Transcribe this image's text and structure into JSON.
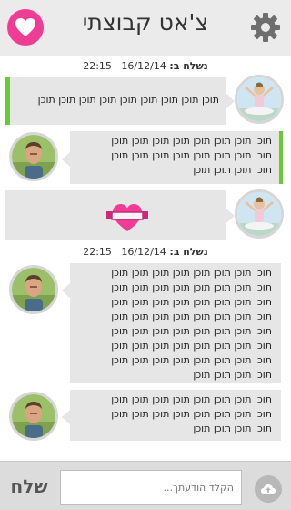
{
  "header": {
    "title": "צ'אט קבוצתי",
    "accent": "#ef3d96"
  },
  "messages": [
    {
      "type": "stamp",
      "label": "נשלח ב:",
      "date": "16/12/14",
      "time": "22:15"
    },
    {
      "type": "text",
      "side": "mine",
      "avatar": "woman-yoga",
      "lines": [
        "תוכן תוכן תוכן תוכן תוכן תוכן תוכן תוכן תוכן"
      ]
    },
    {
      "type": "text",
      "side": "theirs",
      "avatar": "man",
      "lines": [
        "תוכן תוכן תוכן תוכן תוכן תוכן תוכן תוכן",
        "תוכן תוכן תוכן תוכן תוכן תוכן תוכן תוכן",
        "תוכן תוכן תוכן תוכן"
      ]
    },
    {
      "type": "sticker",
      "side": "mine",
      "avatar": "woman-yoga",
      "sticker": "heart-ribbon-icon"
    },
    {
      "type": "stamp",
      "label": "נשלח ב:",
      "date": "16/12/14",
      "time": "22:15"
    },
    {
      "type": "text",
      "side": "theirs",
      "avatar": "man",
      "lines": [
        "תוכן תוכן תוכן תוכן תוכן תוכן תוכן תוכן",
        "תוכן תוכן תוכן תוכן תוכן תוכן תוכן תוכן",
        "תוכן תוכן תוכן תוכן תוכן תוכן תוכן תוכן",
        "תוכן תוכן תוכן תוכן תוכן תוכן תוכן תוכן",
        "תוכן תוכן תוכן תוכן תוכן תוכן תוכן תוכן",
        "תוכן תוכן תוכן תוכן תוכן תוכן תוכן תוכן",
        "תוכן תוכן תוכן תוכן תוכן תוכן תוכן תוכן",
        "תוכן תוכן תוכן תוכן"
      ]
    },
    {
      "type": "text",
      "side": "theirs",
      "avatar": "man",
      "lines": [
        "תוכן תוכן תוכן תוכן תוכן תוכן תוכן תוכן",
        "תוכן תוכן תוכן תוכן תוכן תוכן תוכן תוכן",
        "תוכן תוכן תוכן תוכן"
      ]
    }
  ],
  "composer": {
    "send_label": "שלח",
    "placeholder": "הקלד הודעתך..."
  },
  "colors": {
    "mine_border": "#66cc33",
    "bubble_bg": "#e6e6e6",
    "heart": "#ef3d96"
  }
}
